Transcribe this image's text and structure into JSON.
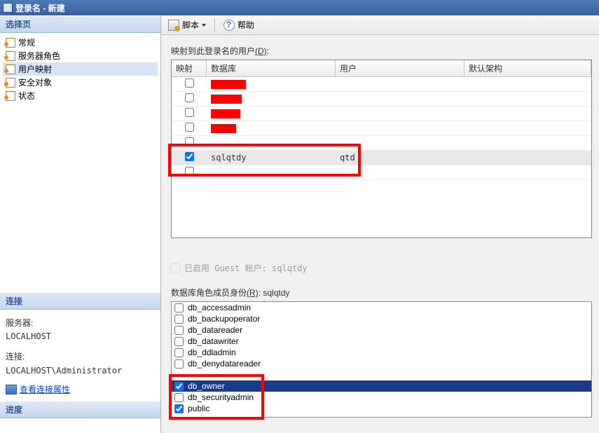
{
  "window": {
    "title": "登录名 - 新建"
  },
  "sections": {
    "select_page": "选择页",
    "connection": "连接",
    "progress": "进度"
  },
  "pages": [
    {
      "label": "常规"
    },
    {
      "label": "服务器角色"
    },
    {
      "label": "用户映射"
    },
    {
      "label": "安全对象"
    },
    {
      "label": "状态"
    }
  ],
  "connection": {
    "server_label": "服务器:",
    "server_value": "LOCALHOST",
    "conn_label": "连接:",
    "conn_value": "LOCALHOST\\Administrator",
    "view_props": "查看连接属性"
  },
  "toolbar": {
    "script": "脚本",
    "help": "帮助"
  },
  "mapping": {
    "label_prefix": "映射到此登录名的用户",
    "label_mnemonic": "(D)",
    "label_suffix": ":",
    "columns": {
      "map": "映射",
      "db": "数据库",
      "user": "用户",
      "schema": "默认架构"
    },
    "rows": [
      {
        "checked": false,
        "db": "",
        "user": "",
        "redact_w": 50,
        "redact_left": 0
      },
      {
        "checked": false,
        "db": "",
        "user": "",
        "redact_w": 44,
        "redact_left": 0
      },
      {
        "checked": false,
        "db": "",
        "user": "",
        "redact_w": 42,
        "redact_left": 0
      },
      {
        "checked": false,
        "db": "",
        "user": "",
        "redact_w": 36,
        "redact_left": 0
      },
      {
        "checked": false,
        "db": "",
        "user": "",
        "redact_w": 0,
        "redact_left": 0
      },
      {
        "checked": true,
        "db": "sqlqtdy",
        "user": "qtd",
        "redact_w": 0,
        "redact_left": 0,
        "selected": true
      },
      {
        "checked": false,
        "db": "",
        "user": "",
        "redact_w": 0,
        "redact_left": 0
      }
    ]
  },
  "guest": {
    "label": "已启用 Guest 帐户: sqlqtdy"
  },
  "roles": {
    "label_prefix": "数据库角色成员身份",
    "label_mnemonic": "(R)",
    "label_suffix": ":  sqlqtdy",
    "items": [
      {
        "name": "db_accessadmin",
        "checked": false
      },
      {
        "name": "db_backupoperator",
        "checked": false
      },
      {
        "name": "db_datareader",
        "checked": false
      },
      {
        "name": "db_datawriter",
        "checked": false
      },
      {
        "name": "db_ddladmin",
        "checked": false
      },
      {
        "name": "db_denydatareader",
        "checked": false
      },
      {
        "name": "",
        "checked": false,
        "hidden_behind_box": true
      },
      {
        "name": "db_owner",
        "checked": true,
        "highlighted": true
      },
      {
        "name": "db_securityadmin",
        "checked": false
      },
      {
        "name": "public",
        "checked": true
      }
    ]
  }
}
